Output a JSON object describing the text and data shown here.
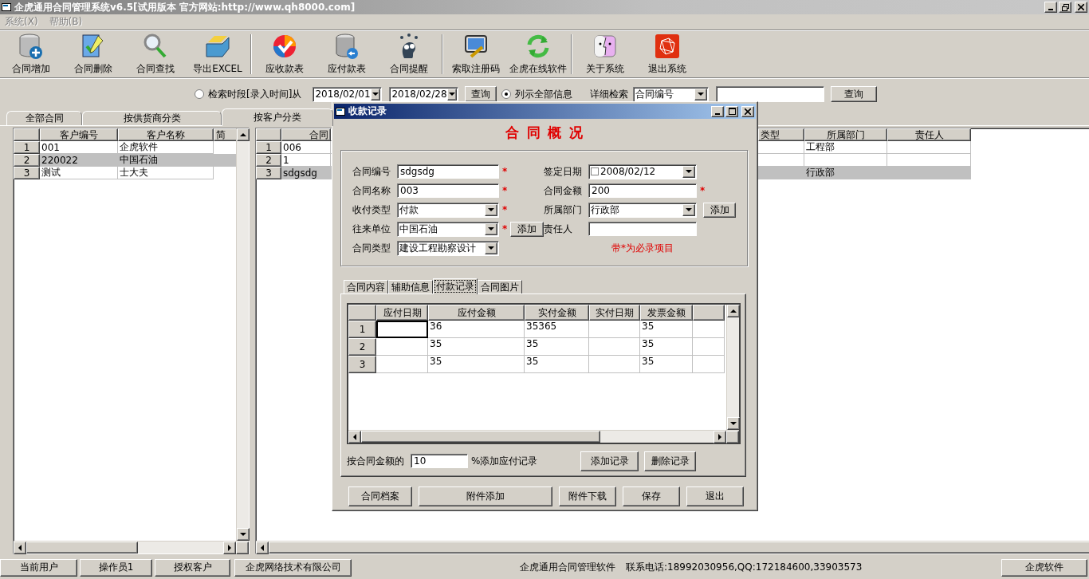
{
  "window": {
    "title": "企虎通用合同管理系统v6.5[试用版本 官方网站:http://www.qh8000.com]"
  },
  "menu": [
    {
      "label": "系统(X)",
      "disabled": true
    },
    {
      "label": "帮助(B)",
      "disabled": true
    }
  ],
  "toolbar_groups": [
    [
      "合同增加",
      "合同删除",
      "合同查找",
      "导出EXCEL"
    ],
    [
      "应收款表",
      "应付款表",
      "合同提醒"
    ],
    [
      "索取注册码",
      "企虎在线软件"
    ],
    [
      "关于系统",
      "退出系统"
    ]
  ],
  "search": {
    "period_radio": {
      "label": "检索时段[录入时间]从",
      "selected": false
    },
    "date_from": "2018/02/01",
    "date_to": "2018/02/28",
    "query_button": "查询",
    "all_radio": {
      "label": "列示全部信息",
      "selected": true
    },
    "detail_label": "详细检索",
    "detail_field": "合同编号",
    "detail_query_button": "查询"
  },
  "tabs": [
    {
      "label": "全部合同",
      "selected": false
    },
    {
      "label": "按供货商分类",
      "selected": false
    },
    {
      "label": "按客户分类",
      "selected": true
    }
  ],
  "customer_table": {
    "columns": [
      "客户编号",
      "客户名称",
      "简"
    ],
    "rows": [
      {
        "index": "1",
        "cells": [
          "001",
          "企虎软件"
        ],
        "selected": false
      },
      {
        "index": "2",
        "cells": [
          "220022",
          "中国石油"
        ],
        "selected": true
      },
      {
        "index": "3",
        "cells": [
          "测试",
          "士大夫"
        ],
        "selected": false
      }
    ]
  },
  "contract_table": {
    "columns": [
      "合同",
      "类型",
      "所属部门",
      "责任人"
    ],
    "rows": [
      {
        "index": "1",
        "contract": "006",
        "department": "工程部",
        "selected": false
      },
      {
        "index": "2",
        "contract": "1",
        "selected": false
      },
      {
        "index": "3",
        "contract": "sdgsdg",
        "department": "行政部",
        "selected": true
      }
    ]
  },
  "dialog": {
    "title": "收款记录",
    "heading": "合 同 概 况",
    "form": {
      "required_mark": "*",
      "note": "带*为必录项目",
      "rows": [
        {
          "left": {
            "label": "合同编号",
            "kind": "text",
            "value": "sdgsdg",
            "required": true
          },
          "right": {
            "label": "签定日期",
            "kind": "date",
            "value": "2008/02/12"
          }
        },
        {
          "left": {
            "label": "合同名称",
            "kind": "text",
            "value": "003",
            "required": true
          },
          "right": {
            "label": "合同金额",
            "kind": "text",
            "value": "200",
            "required": true
          }
        },
        {
          "left": {
            "label": "收付类型",
            "kind": "combo",
            "value": "付款",
            "required": true
          },
          "right": {
            "label": "所属部门",
            "kind": "combo",
            "value": "行政部",
            "add_button": "添加"
          }
        },
        {
          "left": {
            "label": "往来单位",
            "kind": "combo",
            "value": "中国石油",
            "required": true,
            "add_button": "添加"
          },
          "right": {
            "label": "责任人",
            "kind": "text"
          }
        },
        {
          "left": {
            "label": "合同类型",
            "kind": "combo",
            "value": "建设工程勘察设计"
          }
        }
      ]
    },
    "tabs": [
      {
        "label": "合同内容",
        "selected": false
      },
      {
        "label": "辅助信息",
        "selected": false
      },
      {
        "label": "付款记录",
        "selected": true
      },
      {
        "label": "合同图片",
        "selected": false
      }
    ],
    "payment_table": {
      "columns": [
        "应付日期",
        "应付金额",
        "实付金额",
        "实付日期",
        "发票金额"
      ],
      "rows": [
        {
          "index": "1",
          "due_amount": "36",
          "paid_amount": "35365",
          "invoice_amount": "35",
          "focused": true
        },
        {
          "index": "2",
          "due_amount": "35",
          "paid_amount": "35",
          "invoice_amount": "35",
          "focused": false
        },
        {
          "index": "3",
          "due_amount": "35",
          "paid_amount": "35",
          "invoice_amount": "35",
          "focused": false
        }
      ]
    },
    "percent": {
      "label": "按合同金额的",
      "value": "10",
      "suffix": "%添加应付记录"
    },
    "record_buttons": [
      "添加记录",
      "删除记录"
    ],
    "bottom_buttons": [
      "合同档案",
      "附件添加",
      "附件下载",
      "保存",
      "退出"
    ]
  },
  "status_bar": {
    "panels": [
      "当前用户",
      "操作员1",
      "授权客户",
      "企虎网络技术有限公司"
    ],
    "app_name": "企虎通用合同管理软件",
    "contact": "联系电话:18992030956,QQ:172184600,33903573",
    "right": "企虎软件"
  }
}
